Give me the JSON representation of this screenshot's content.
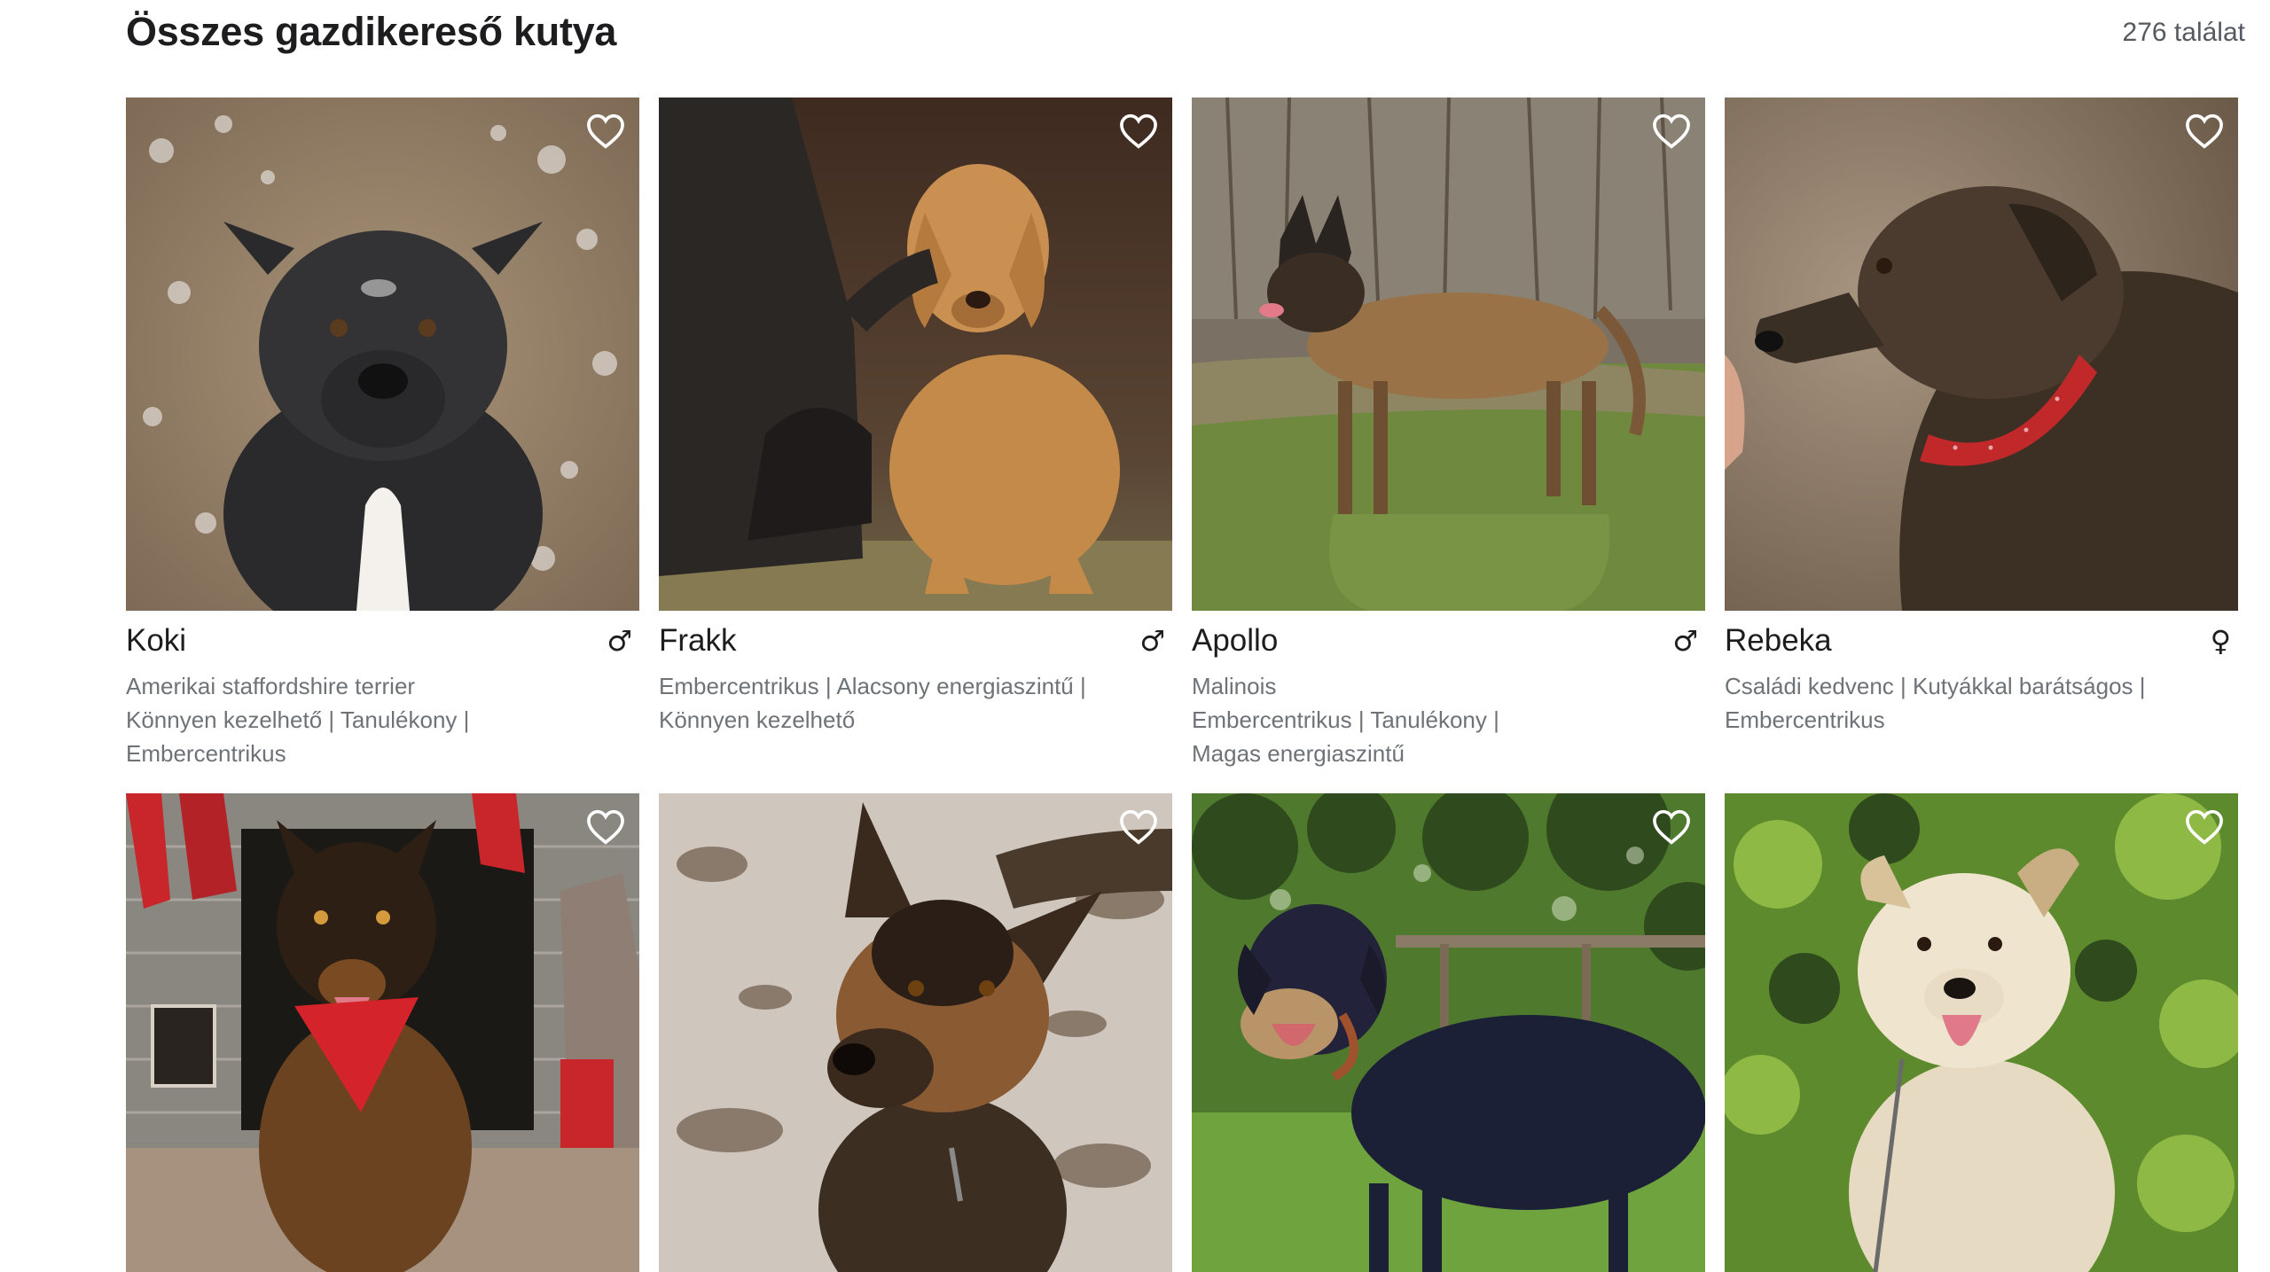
{
  "header": {
    "title": "Összes gazdikereső kutya",
    "result_count": "276 találat"
  },
  "colors": {
    "text_primary": "#1d1d1f",
    "text_secondary": "#6e7378",
    "heart_outline": "#ffffff"
  },
  "dogs": [
    {
      "name": "Koki",
      "sex": "♂",
      "sex_icon": "male-icon",
      "traits": "Amerikai staffordshire terrier\nKönnyen kezelhető | Tanulékony |\nEmbercentrikus",
      "photo_desc": "black-staffy-in-snow"
    },
    {
      "name": "Frakk",
      "sex": "♂",
      "sex_icon": "male-icon",
      "traits": "Embercentrikus | Alacsony energiaszintű |\nKönnyen kezelhető",
      "photo_desc": "golden-dog-petted"
    },
    {
      "name": "Apollo",
      "sex": "♂",
      "sex_icon": "male-icon",
      "traits": "Malinois\nEmbercentrikus | Tanulékony |\nMagas energiaszintű",
      "photo_desc": "malinois-in-field"
    },
    {
      "name": "Rebeka",
      "sex": "♀",
      "sex_icon": "female-icon",
      "traits": "Családi kedvenc | Kutyákkal barátságos |\nEmbercentrikus",
      "photo_desc": "brindle-dog-red-collar"
    },
    {
      "photo_desc": "dog-red-bandana-fireplace"
    },
    {
      "photo_desc": "german-shepherd-snow"
    },
    {
      "photo_desc": "dachshund-mix-grass"
    },
    {
      "photo_desc": "white-shaggy-dog-garden"
    }
  ]
}
